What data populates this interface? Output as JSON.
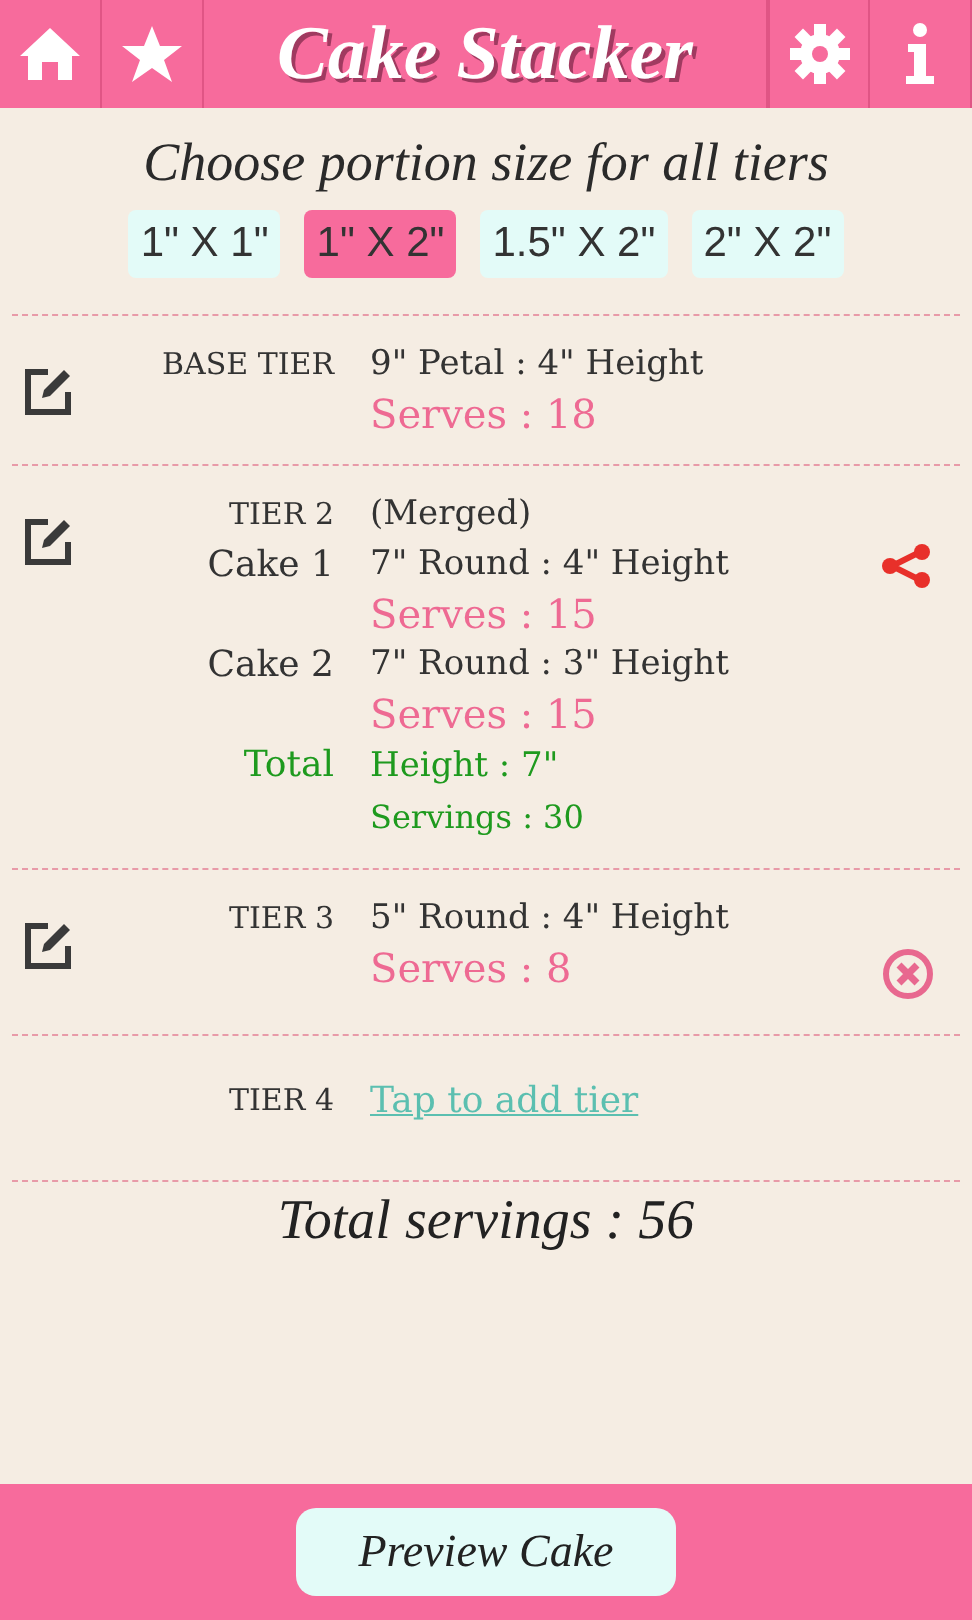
{
  "header": {
    "title": "Cake Stacker"
  },
  "portion": {
    "prompt": "Choose portion size for all tiers",
    "options": [
      {
        "label": "1\" X 1\"",
        "selected": false
      },
      {
        "label": "1\" X 2\"",
        "selected": true
      },
      {
        "label": "1.5\" X 2\"",
        "selected": false
      },
      {
        "label": "2\" X 2\"",
        "selected": false
      }
    ]
  },
  "tiers": [
    {
      "editable": true,
      "rows": [
        {
          "label": {
            "text": "BASE TIER",
            "kind": "tier"
          },
          "kind": "spec",
          "text": "9\" Petal : 4\" Height"
        },
        {
          "kind": "serves",
          "text": "Serves : 18"
        }
      ]
    },
    {
      "editable": true,
      "action": {
        "kind": "merge"
      },
      "rows": [
        {
          "label": {
            "text": "TIER 2",
            "kind": "tier"
          },
          "kind": "spec",
          "text": "(Merged)"
        },
        {
          "label": {
            "text": "Cake 1",
            "kind": "cake"
          },
          "kind": "spec",
          "text": "7\" Round : 4\" Height"
        },
        {
          "kind": "serves",
          "text": "Serves : 15"
        },
        {
          "label": {
            "text": "Cake 2",
            "kind": "cake"
          },
          "kind": "spec",
          "text": "7\" Round : 3\" Height"
        },
        {
          "kind": "serves",
          "text": "Serves : 15"
        },
        {
          "label": {
            "text": "Total",
            "kind": "total"
          },
          "kind": "total",
          "text": "Height : 7\""
        },
        {
          "kind": "total-small",
          "text": "Servings : 30"
        }
      ]
    },
    {
      "editable": true,
      "action": {
        "kind": "remove"
      },
      "rows": [
        {
          "label": {
            "text": "TIER 3",
            "kind": "tier"
          },
          "kind": "spec",
          "text": "5\" Round : 4\" Height"
        },
        {
          "kind": "serves",
          "text": "Serves : 8"
        }
      ]
    },
    {
      "editable": false,
      "rows": [
        {
          "label": {
            "text": "TIER 4",
            "kind": "tier"
          },
          "kind": "link",
          "text": "Tap to add tier"
        }
      ]
    }
  ],
  "total": "Total servings : 56",
  "footer": {
    "button": "Preview Cake"
  }
}
